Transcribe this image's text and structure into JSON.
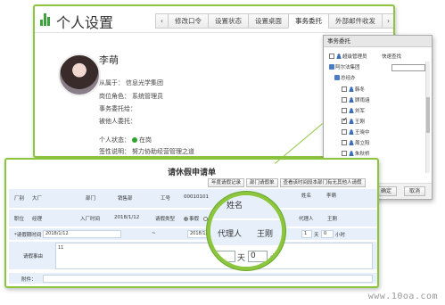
{
  "settings": {
    "title": "个人设置",
    "tabs": [
      "修改口令",
      "设置状态",
      "设置桌面",
      "事务委托",
      "外部邮件收发"
    ],
    "active_tab": "事务委托",
    "profile": {
      "name": "李萌",
      "line1_label": "从属于：",
      "line1_value": "信息光学集团",
      "line2_label": "岗位角色：",
      "line2_value": "系统管理员",
      "line3_label": "事务委托给：",
      "line4_label": "被他人委托：",
      "line5_label": "个人状态：",
      "line5_value": "在岗",
      "line6_label": "签性说明：",
      "line6_value": "努力协助经营管理之道"
    }
  },
  "delegate_panel": {
    "title": "事务委托",
    "super_admin_label": "超级管理员",
    "quick_search_label": "快速查找",
    "tree": {
      "root": "阿尔法集团",
      "dept": "总经办",
      "people": [
        {
          "name": "韩冬",
          "checked": false
        },
        {
          "name": "顾雨涵",
          "checked": false
        },
        {
          "name": "刘军",
          "checked": false
        },
        {
          "name": "王刚",
          "checked": true
        },
        {
          "name": "王晓中",
          "checked": false
        },
        {
          "name": "周立阳",
          "checked": false
        },
        {
          "name": "朱秋桥",
          "checked": false
        }
      ]
    },
    "ok_label": "确定",
    "cancel_label": "取消"
  },
  "leave_form": {
    "title": "请休假申请单",
    "toolbar": [
      "年度请假记录",
      "部门请假单",
      "查看该时间段本部门有无其他人请假"
    ],
    "row1": {
      "factory_label": "厂别",
      "factory_value": "大厂",
      "dept_label": "部门",
      "dept_value": "销售部",
      "emp_no_label": "工号",
      "emp_no_value": "00010101",
      "name_label": "姓名",
      "name_value": "李萌",
      "name_label_left": "姓名"
    },
    "row2": {
      "position_label": "职位",
      "position_value": "经理",
      "join_label": "入厂时间",
      "join_value": "2018/1/12",
      "type_label": "请假类型",
      "type_opt1": "事假",
      "type_opt2": "病",
      "agent_label": "代理人",
      "agent_value": "王刚"
    },
    "row3": {
      "period_label": "*请假期时间",
      "start_value": "2018/1/12",
      "to_sep": "~",
      "end_value": "2018/1/13",
      "days_value": "1",
      "days_label": "天",
      "hours_value": "0",
      "hours_label": "小时"
    },
    "row4": {
      "reason_label": "请假事由",
      "reason_value": "11"
    },
    "row5": {
      "attach_label": "附件："
    }
  },
  "magnifier": {
    "top_label": "姓名",
    "agent_label": "代理人",
    "agent_value": "王刚",
    "days_label": "天",
    "hours_value": "0",
    "hours_label": "小时"
  },
  "watermark": "www.10oa.com",
  "colors": {
    "accent": "#8cc63f",
    "form_row": "#e6effa",
    "status_online": "#2ea42e"
  }
}
